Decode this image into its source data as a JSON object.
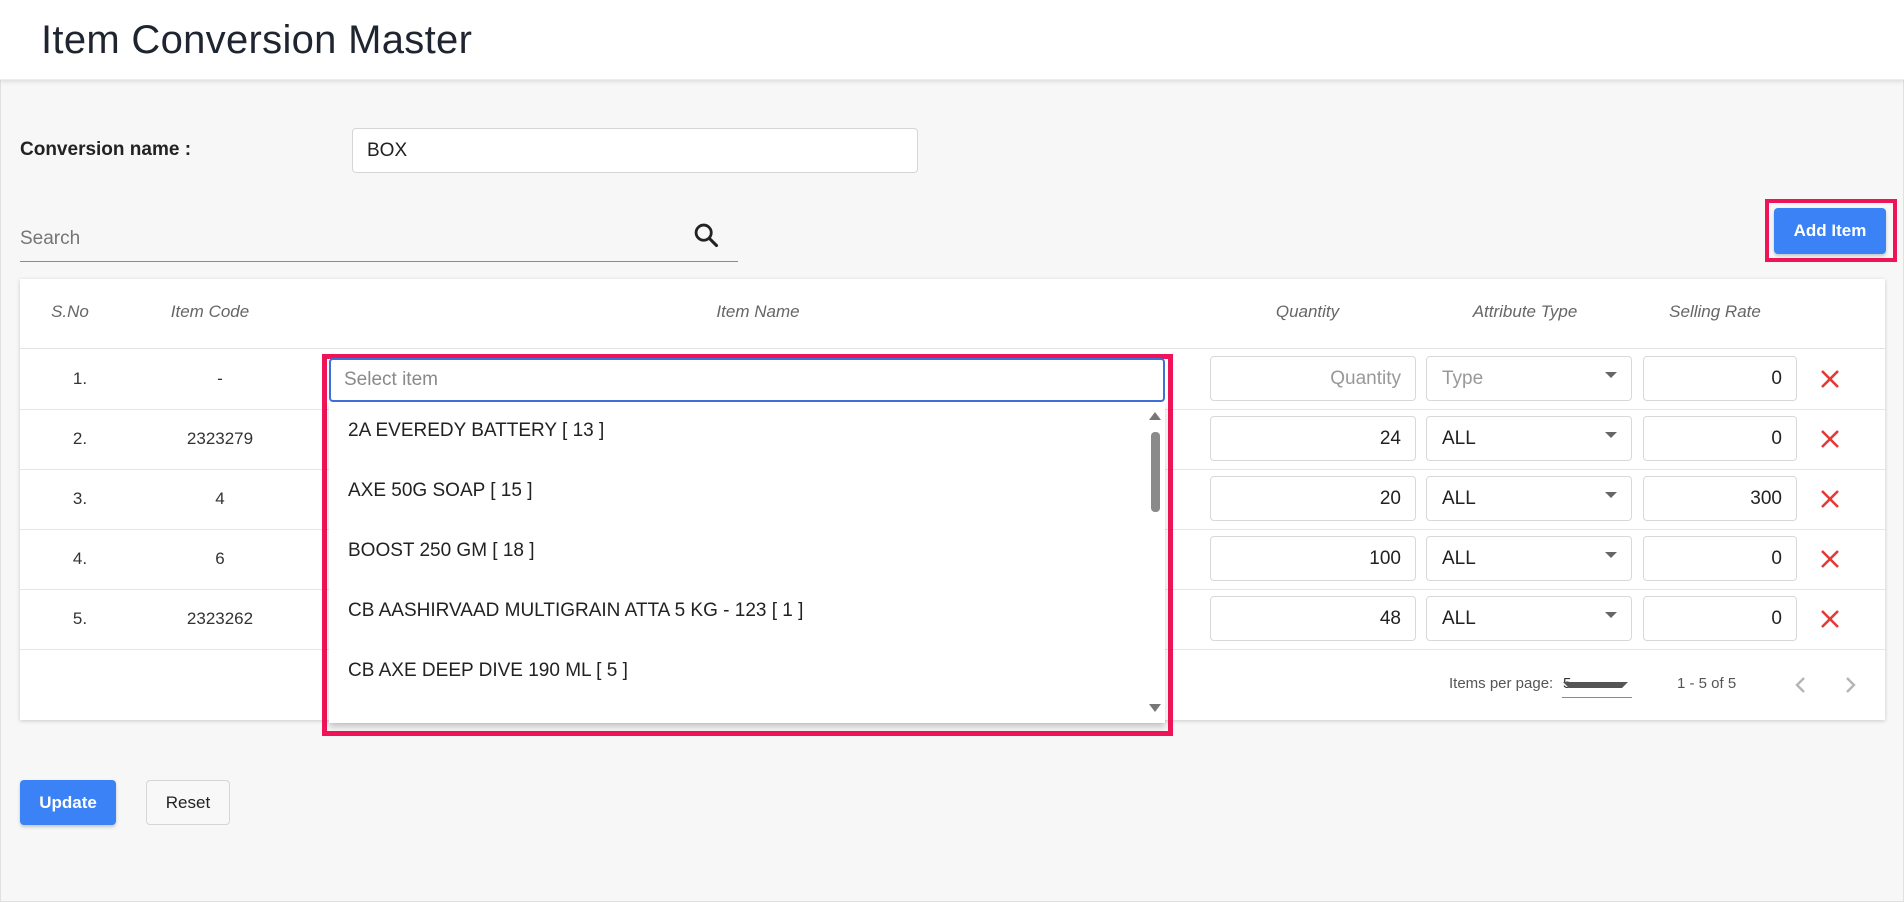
{
  "header": {
    "title": "Item Conversion Master"
  },
  "form": {
    "conversion_label": "Conversion name :",
    "conversion_value": "BOX"
  },
  "search": {
    "placeholder": "Search"
  },
  "toolbar": {
    "add_item_label": "Add Item"
  },
  "table": {
    "columns": [
      "S.No",
      "Item Code",
      "Item Name",
      "Quantity",
      "Attribute Type",
      "Selling Rate"
    ],
    "rows": [
      {
        "sno": "1.",
        "code": "-",
        "quantity": "",
        "quantity_placeholder": "Quantity",
        "type": "",
        "type_placeholder": "Type",
        "rate": "0"
      },
      {
        "sno": "2.",
        "code": "2323279",
        "quantity": "24",
        "type": "ALL",
        "rate": "0"
      },
      {
        "sno": "3.",
        "code": "4",
        "quantity": "20",
        "type": "ALL",
        "rate": "300"
      },
      {
        "sno": "4.",
        "code": "6",
        "quantity": "100",
        "type": "ALL",
        "rate": "0"
      },
      {
        "sno": "5.",
        "code": "2323262",
        "quantity": "48",
        "type": "ALL",
        "rate": "0"
      }
    ]
  },
  "paginator": {
    "items_per_page_label": "Items per page:",
    "page_size": "5",
    "range_label": "1 - 5 of 5"
  },
  "dropdown": {
    "placeholder": "Select item",
    "options": [
      "2A EVEREDY BATTERY [ 13 ]",
      "AXE 50G SOAP [ 15 ]",
      "BOOST 250 GM [ 18 ]",
      "CB AASHIRVAAD MULTIGRAIN ATTA 5 KG - 123 [ 1 ]",
      "CB AXE DEEP DIVE 190 ML [ 5 ]"
    ]
  },
  "actions": {
    "update_label": "Update",
    "reset_label": "Reset"
  },
  "colors": {
    "primary": "#3b82f6",
    "highlight": "#ee1457",
    "delete": "#e53935",
    "focus": "#3f6fd8"
  },
  "icons": {
    "search": "search-icon",
    "delete": "close-icon",
    "prev": "chevron-left-icon",
    "next": "chevron-right-icon"
  }
}
